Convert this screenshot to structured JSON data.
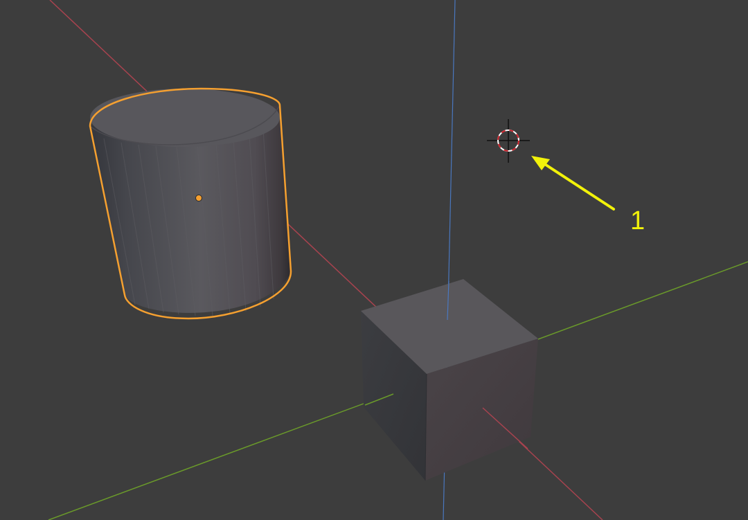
{
  "viewport": {
    "background": "#3d3d3d",
    "axes": {
      "x_color": "#a8434f",
      "y_color": "#6a9a2a",
      "z_color": "#4a78c0"
    }
  },
  "objects": [
    {
      "name": "Cylinder",
      "selected": true,
      "outline_color": "#f5a030",
      "origin_color": "#f5a030"
    },
    {
      "name": "Cube",
      "selected": false
    }
  ],
  "cursor_3d": {
    "icon": "3d-cursor-icon"
  },
  "annotation": {
    "label": "1",
    "color": "#f2f20a",
    "icon": "arrow-icon"
  }
}
